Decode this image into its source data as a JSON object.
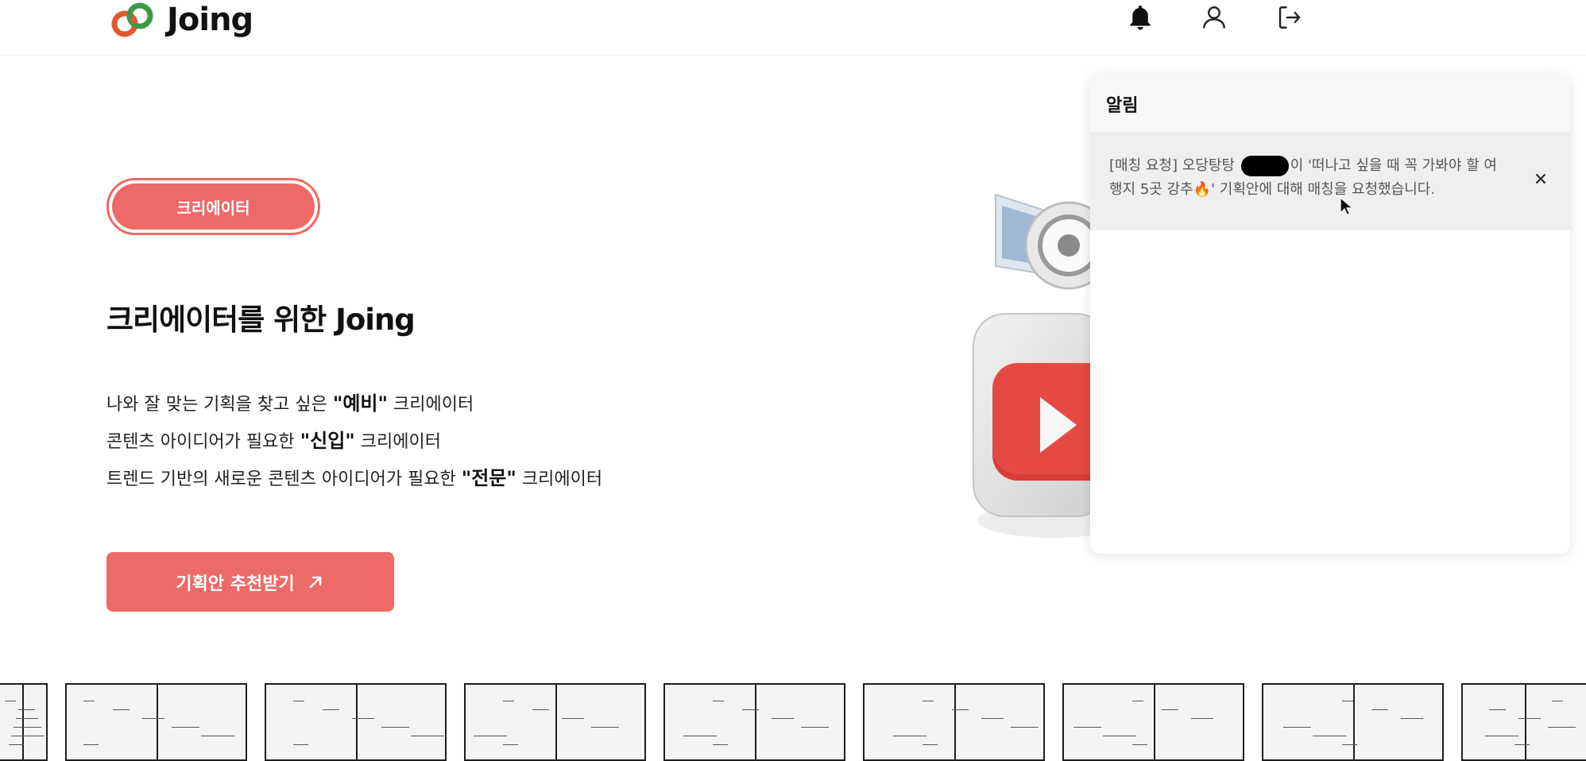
{
  "header": {
    "logo_text": "Joing",
    "icons": [
      "bell-icon",
      "user-icon",
      "logout-icon"
    ]
  },
  "hero": {
    "pill_label": "크리에이터",
    "title": "크리에이터를 위한 Joing",
    "lines": [
      {
        "before": "나와 잘 맞는 기획을 찾고 싶은 ",
        "emph": "\"예비\"",
        "after": " 크리에이터"
      },
      {
        "before": "콘텐츠 아이디어가 필요한 ",
        "emph": "\"신입\"",
        "after": " 크리에이터"
      },
      {
        "before": "트렌드 기반의 새로운 콘텐츠 아이디어가 필요한 ",
        "emph": "\"전문\"",
        "after": " 크리에이터"
      }
    ],
    "cta_label": "기획안 추천받기"
  },
  "notifications": {
    "title": "알림",
    "items": [
      {
        "text_before": "[매칭 요청] 오당탕탕 ",
        "text_after": "이 '떠나고 싶을 때 꼭 가봐야 할 여행지 5곳 강추🔥' 기획안에 대해 매칭을 요청했습니다."
      }
    ]
  },
  "colors": {
    "accent": "#ee6a66",
    "panel_head": "#f7f7f7",
    "panel_item": "#efefef"
  },
  "comic_strip": {
    "count": 10
  }
}
